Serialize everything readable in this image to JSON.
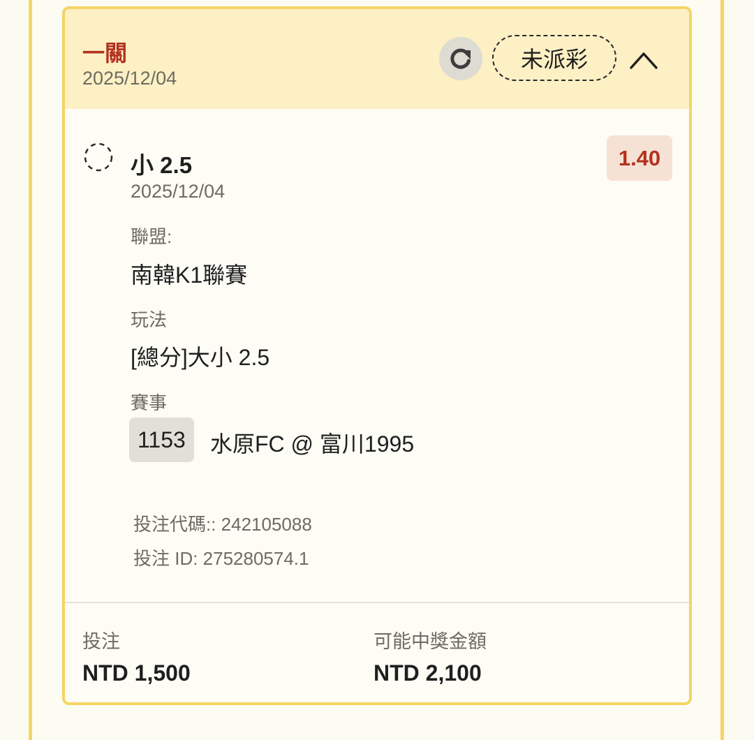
{
  "bet": {
    "type_label": "一關",
    "date": "2025/12/04",
    "status": "未派彩",
    "refresh_icon": "refresh-icon",
    "collapse_icon": "chevron-up-icon"
  },
  "selection": {
    "name": "小 2.5",
    "date": "2025/12/04",
    "odds": "1.40",
    "league_label": "聯盟:",
    "league_value": "南韓K1聯賽",
    "market_label": "玩法",
    "market_value": "[總分]大小 2.5",
    "event_label": "賽事",
    "event_code": "1153",
    "event_name": "水原FC @ 富川1995",
    "bet_code_line": "投注代碼:: 242105088",
    "bet_id_line": "投注 ID: 275280574.1"
  },
  "footer": {
    "stake_label": "投注",
    "stake_value": "NTD 1,500",
    "payout_label": "可能中獎金額",
    "payout_value": "NTD 2,100"
  },
  "colors": {
    "accent_red": "#b3321f",
    "border_yellow": "#f4d565",
    "header_bg": "#fcf0c4",
    "odds_bg": "#f6e2d4"
  }
}
